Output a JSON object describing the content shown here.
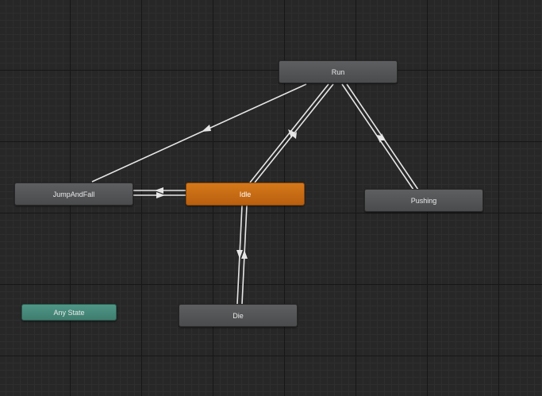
{
  "graph": {
    "nodes": {
      "run": {
        "label": "Run"
      },
      "idle": {
        "label": "Idle"
      },
      "jump_and_fall": {
        "label": "JumpAndFall"
      },
      "pushing": {
        "label": "Pushing"
      },
      "die": {
        "label": "Die"
      },
      "any_state": {
        "label": "Any State"
      }
    },
    "colors": {
      "default_state": "#555658",
      "active_state": "#c86a14",
      "any_state": "#478a7b",
      "transition": "#e6e6e6",
      "background": "#272727"
    },
    "transitions": [
      {
        "from": "Run",
        "to": "JumpAndFall"
      },
      {
        "from": "Run",
        "to": "Idle"
      },
      {
        "from": "Idle",
        "to": "Run"
      },
      {
        "from": "Run",
        "to": "Pushing"
      },
      {
        "from": "Pushing",
        "to": "Run"
      },
      {
        "from": "JumpAndFall",
        "to": "Idle"
      },
      {
        "from": "Idle",
        "to": "JumpAndFall"
      },
      {
        "from": "Idle",
        "to": "Die"
      },
      {
        "from": "Die",
        "to": "Idle"
      }
    ]
  }
}
